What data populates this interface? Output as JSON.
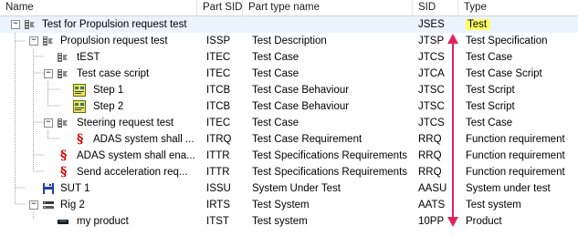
{
  "columns": {
    "name": "Name",
    "part_sid": "Part SID",
    "part_type_name": "Part type name",
    "sid": "SID",
    "type": "Type"
  },
  "rows": [
    {
      "name": "Test for Propulsion request test",
      "part_sid": "",
      "part_type_name": "",
      "sid": "JSES",
      "type": "Test",
      "icon": "test-folder-icon",
      "selected": true,
      "highlight": true
    },
    {
      "name": "Propulsion request test",
      "part_sid": "ISSP",
      "part_type_name": "Test Description",
      "sid": "JTSP",
      "type": "Test Specification",
      "icon": "test-folder-icon"
    },
    {
      "name": "tEST",
      "part_sid": "ITEC",
      "part_type_name": "Test Case",
      "sid": "JTCS",
      "type": "Test Case",
      "icon": "test-case-icon"
    },
    {
      "name": "Test case script",
      "part_sid": "ITEC",
      "part_type_name": "Test Case",
      "sid": "JTCA",
      "type": "Test Case Script",
      "icon": "test-folder-icon"
    },
    {
      "name": "Step 1",
      "part_sid": "ITCB",
      "part_type_name": "Test Case Behaviour",
      "sid": "JTSC",
      "type": "Test Script",
      "icon": "test-script-icon"
    },
    {
      "name": "Step 2",
      "part_sid": "ITCB",
      "part_type_name": "Test Case Behaviour",
      "sid": "JTSC",
      "type": "Test Script",
      "icon": "test-script-icon"
    },
    {
      "name": "Steering request test",
      "part_sid": "ITEC",
      "part_type_name": "Test Case",
      "sid": "JTCS",
      "type": "Test Case",
      "icon": "test-folder-icon"
    },
    {
      "name": "ADAS system shall ...",
      "part_sid": "ITRQ",
      "part_type_name": "Test Case Requirement",
      "sid": "RRQ",
      "type": "Function requirement",
      "icon": "requirement-icon"
    },
    {
      "name": "ADAS system shall ena...",
      "part_sid": "ITTR",
      "part_type_name": "Test Specifications Requirements",
      "sid": "RRQ",
      "type": "Function requirement",
      "icon": "requirement-icon"
    },
    {
      "name": "Send acceleration req...",
      "part_sid": "ITTR",
      "part_type_name": "Test Specifications Requirements",
      "sid": "RRQ",
      "type": "Function requirement",
      "icon": "requirement-icon"
    },
    {
      "name": "SUT 1",
      "part_sid": "ISSU",
      "part_type_name": "System Under Test",
      "sid": "AASU",
      "type": "System under test",
      "icon": "floppy-disk-icon"
    },
    {
      "name": "Rig 2",
      "part_sid": "IRTS",
      "part_type_name": "Test System",
      "sid": "AATS",
      "type": "Test system",
      "icon": "test-rig-icon"
    },
    {
      "name": "my product",
      "part_sid": "ITST",
      "part_type_name": "Test system",
      "sid": "10PP",
      "type": "Product",
      "icon": "product-icon"
    }
  ],
  "colors": {
    "arrow": "#e0245e",
    "highlight": "#ffff66",
    "selection": "#cce8ff"
  }
}
